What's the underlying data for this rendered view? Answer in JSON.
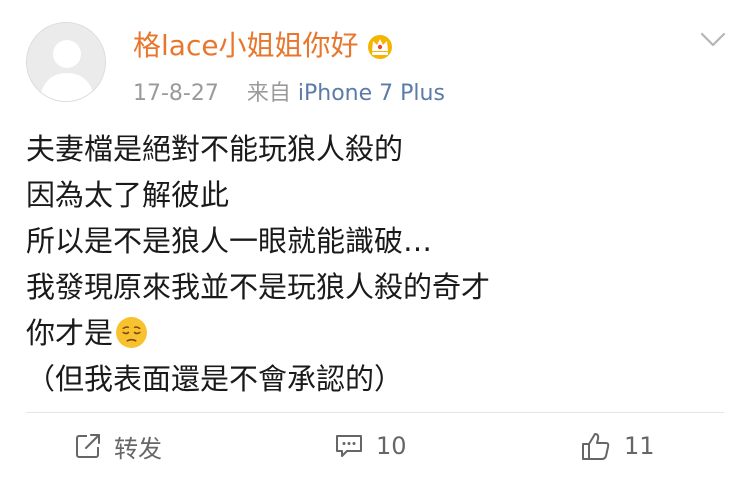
{
  "post": {
    "username": "格lace小姐姐你好",
    "date": "17-8-27",
    "source_prefix": "来自",
    "source_name": "iPhone 7 Plus",
    "lines": [
      "夫妻檔是絕對不能玩狼人殺的",
      "因為太了解彼此",
      "所以是不是狼人一眼就能識破…",
      "我發現原來我並不是玩狼人殺的奇才",
      "你才是",
      "（但我表面還是不會承認的）"
    ],
    "emoji": "pensive-face"
  },
  "actions": {
    "repost_label": "转发",
    "comment_count": "10",
    "like_count": "11"
  },
  "icons": {
    "avatar": "default-avatar-silhouette",
    "vip": "crown-badge-icon",
    "menu": "chevron-down-icon",
    "repost": "share-arrow-icon",
    "comment": "comment-bubble-icon",
    "like": "thumbs-up-icon"
  },
  "colors": {
    "username": "#e8772e",
    "source": "#5b7ba8",
    "meta": "#9a9a9a",
    "action": "#666666",
    "divider": "#e6e6e6"
  }
}
